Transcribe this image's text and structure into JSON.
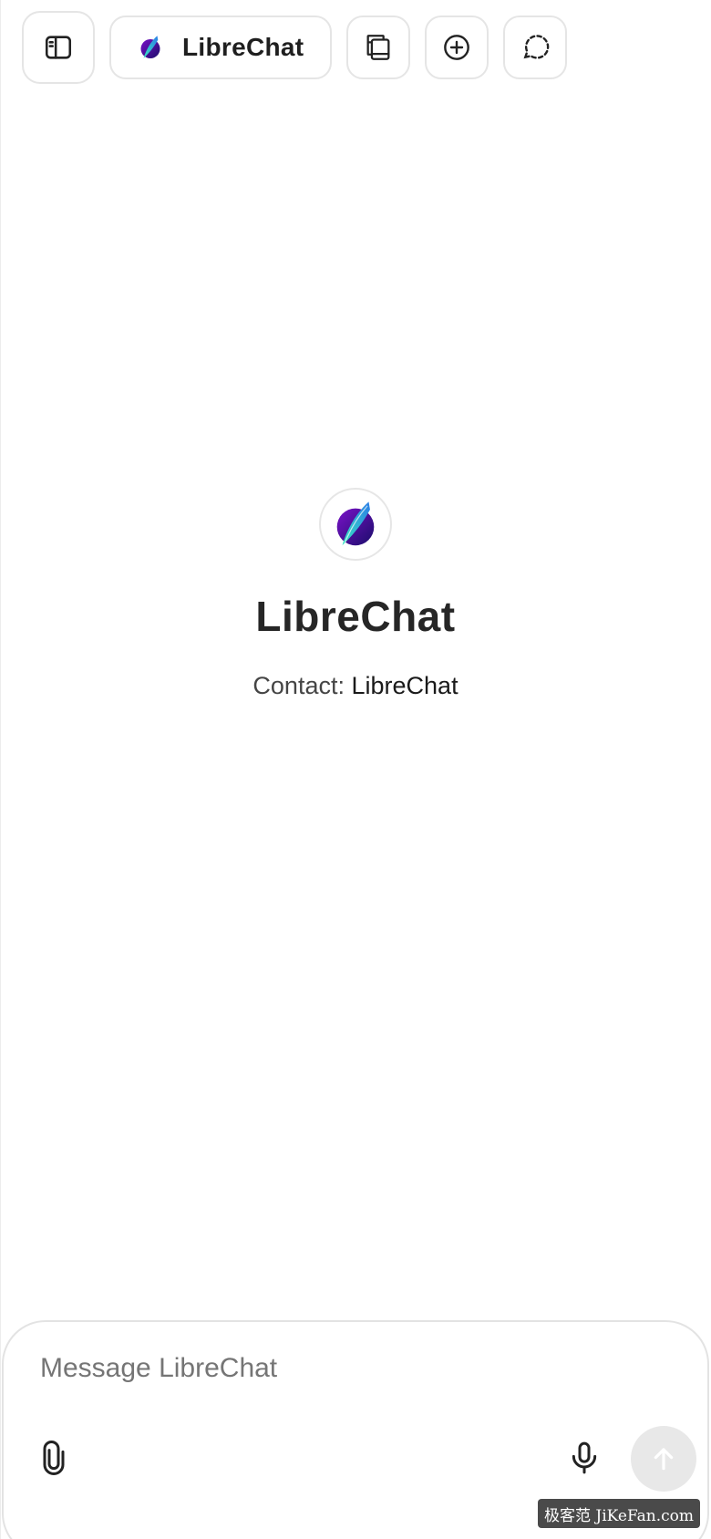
{
  "toolbar": {
    "sidebar_toggle_icon": "sidebar-panel-icon",
    "model_selector": {
      "label": "LibreChat",
      "icon": "librechat-feather-logo"
    },
    "bookmarks_icon": "copy-book-icon",
    "new_chat_icon": "plus-circle-icon",
    "temporary_chat_icon": "dashed-message-circle-icon"
  },
  "hero": {
    "logo": "librechat-feather-logo",
    "title": "LibreChat",
    "contact_label": "Contact:",
    "contact_name": "LibreChat"
  },
  "composer": {
    "placeholder": "Message LibreChat",
    "attach_icon": "paperclip-icon",
    "mic_icon": "microphone-icon",
    "send_icon": "arrow-up-icon"
  },
  "watermark": {
    "text": "极客范 JiKeFan.com"
  },
  "colors": {
    "border": "#e5e5e5",
    "logo_purple": "#3b0f7a",
    "logo_cyan": "#2fd3e0",
    "send_disabled_bg": "#e8e8e8"
  }
}
